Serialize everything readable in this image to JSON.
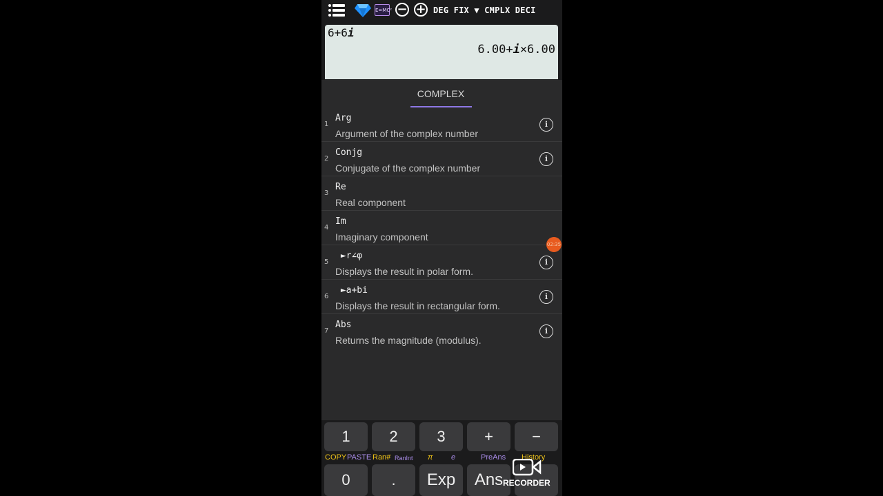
{
  "status_bar": {
    "emc_label": "E=MC²",
    "minus_label": "−",
    "plus_label": "+",
    "mode_text": "DEG FIX ▼ CMPLX DECI"
  },
  "display": {
    "expression": "6+6",
    "expression_i": "i",
    "result_left": "6.00+",
    "result_i": "i",
    "result_right": "×6.00"
  },
  "panel": {
    "tab_label": "COMPLEX",
    "items": [
      {
        "num": "1",
        "name": "Arg",
        "desc": "Argument of the complex number",
        "info": "i"
      },
      {
        "num": "2",
        "name": "Conjg",
        "desc": "Conjugate of the complex number",
        "info": "i"
      },
      {
        "num": "3",
        "name": "Re",
        "desc": "Real component"
      },
      {
        "num": "4",
        "name": "Im",
        "desc": "Imaginary component"
      },
      {
        "num": "5",
        "name": " ►r∠φ",
        "desc": "Displays the result in polar form.",
        "info": "i"
      },
      {
        "num": "6",
        "name": " ►a+bi",
        "desc": "Displays the result in rectangular form.",
        "info": "i"
      },
      {
        "num": "7",
        "name": "Abs",
        "desc": "Returns the magnitude (modulus).",
        "info": "i"
      }
    ]
  },
  "overlay": {
    "timer": "02:35",
    "recorder_label": "RECORDER"
  },
  "keypad": {
    "row1": [
      "1",
      "2",
      "3",
      "+",
      "−"
    ],
    "sublabels": {
      "copy": "COPY",
      "paste": "PASTE",
      "ran": "Ran#",
      "ranint": "RanInt",
      "pi": "π",
      "e": "e",
      "preans": "PreAns",
      "history": "History"
    },
    "row2": [
      "0",
      ".",
      "Exp",
      "Ans",
      ""
    ]
  },
  "colors": {
    "accent": "#8e78e6",
    "display_bg": "#dfe8e5",
    "panel_bg": "#2a2a2b",
    "key_bg": "#3a3a3c",
    "yellow_label": "#f0c419",
    "purple_label": "#a98ce8"
  }
}
